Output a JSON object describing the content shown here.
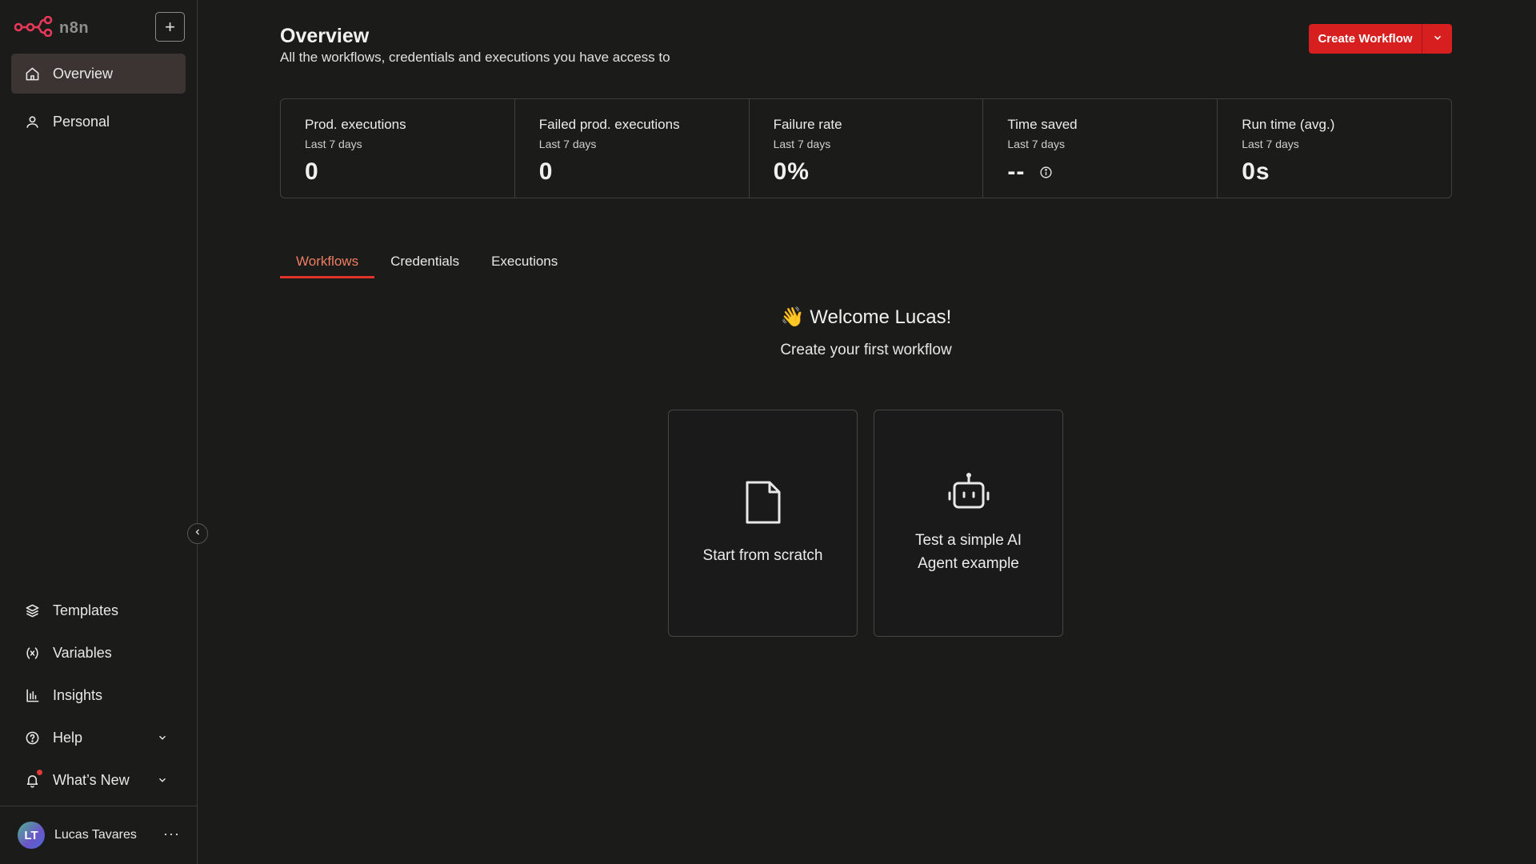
{
  "app": {
    "name": "n8n",
    "accent": "#d71f1f",
    "tab_accent": "#ef7d63"
  },
  "sidebar": {
    "new_button": "+",
    "items": [
      {
        "label": "Overview",
        "icon": "home-icon",
        "active": true
      },
      {
        "label": "Personal",
        "icon": "user-icon",
        "active": false
      }
    ],
    "bottom_items": [
      {
        "label": "Templates",
        "icon": "templates-icon"
      },
      {
        "label": "Variables",
        "icon": "variables-icon"
      },
      {
        "label": "Insights",
        "icon": "insights-icon"
      },
      {
        "label": "Help",
        "icon": "help-icon"
      },
      {
        "label": "What’s New",
        "icon": "bell-icon"
      }
    ],
    "user": {
      "initials": "LT",
      "name": "Lucas Tavares",
      "more": "···"
    }
  },
  "header": {
    "title": "Overview",
    "subtitle": "All the workflows, credentials and executions you have access to",
    "create_button": "Create Workflow"
  },
  "stats": [
    {
      "label": "Prod. executions",
      "period": "Last 7 days",
      "value": "0"
    },
    {
      "label": "Failed prod. executions",
      "period": "Last 7 days",
      "value": "0"
    },
    {
      "label": "Failure rate",
      "period": "Last 7 days",
      "value": "0%"
    },
    {
      "label": "Time saved",
      "period": "Last 7 days",
      "value": "--"
    },
    {
      "label": "Run time (avg.)",
      "period": "Last 7 days",
      "value": "0s"
    }
  ],
  "tabs": [
    {
      "label": "Workflows",
      "active": true
    },
    {
      "label": "Credentials",
      "active": false
    },
    {
      "label": "Executions",
      "active": false
    }
  ],
  "welcome": {
    "emoji": "👋",
    "title": "Welcome Lucas!",
    "subtitle": "Create your first workflow"
  },
  "cards": [
    {
      "label": "Start from scratch",
      "icon": "file-icon"
    },
    {
      "label": "Test a simple AI\nAgent example",
      "icon": "robot-icon"
    }
  ]
}
